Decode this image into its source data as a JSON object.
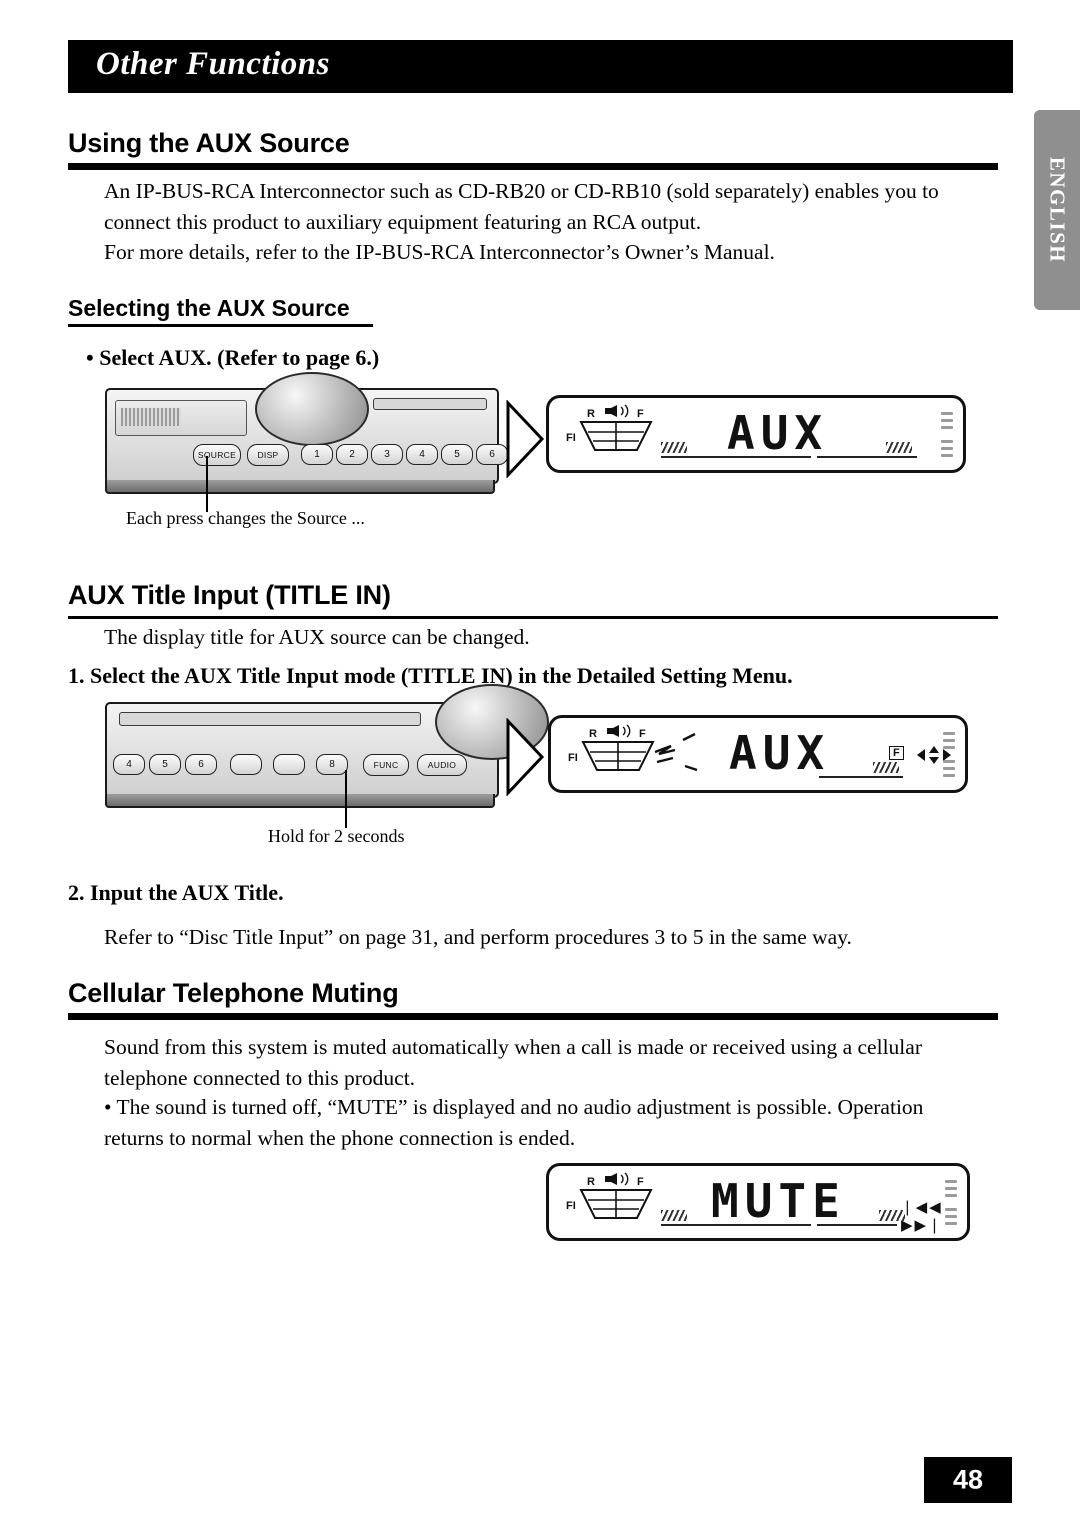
{
  "header": {
    "title": "Other Functions",
    "language_tab": "ENGLISH",
    "page_number": "48"
  },
  "sections": [
    {
      "id": "using-aux-source",
      "heading": "Using the AUX Source",
      "paragraphs": [
        "An IP-BUS-RCA Interconnector such as CD-RB20 or CD-RB10 (sold separately) enables you to connect this product to auxiliary equipment featuring an RCA output.",
        "For more details, refer to the IP-BUS-RCA Interconnector’s Owner’s Manual."
      ],
      "subheading": "Selecting the AUX Source",
      "bullet": "•  Select AUX. (Refer to page 6.)",
      "figure_caption": "Each press changes the Source ..."
    },
    {
      "id": "aux-title-input",
      "heading": "AUX Title Input (TITLE IN)",
      "paragraph": "The display title for AUX source can be changed.",
      "step1": "1.  Select the AUX Title Input mode (TITLE IN) in the Detailed Setting Menu.",
      "figure_caption": "Hold for 2 seconds",
      "step2": "2.  Input the AUX Title.",
      "step2_body": "Refer to “Disc Title Input” on page 31, and perform procedures 3 to 5 in the same way."
    },
    {
      "id": "cellular-telephone-muting",
      "heading": "Cellular Telephone Muting",
      "paragraphs": [
        "Sound from this system is muted automatically when a call is made or received using a cellular telephone connected to this product.",
        "•  The sound is turned off, “MUTE” is displayed and no audio adjustment is possible. Operation returns to normal when the phone connection is ended."
      ]
    }
  ],
  "unit_figures": {
    "top": {
      "buttons": [
        "SOURCE",
        "DISP"
      ],
      "preset_numbers": [
        "1",
        "2",
        "3",
        "4",
        "5",
        "6"
      ]
    },
    "middle": {
      "buttons": [
        "FUNC",
        "AUDIO"
      ],
      "preset_numbers": [
        "4",
        "5",
        "6",
        "8"
      ]
    }
  },
  "displays": [
    {
      "id": "display-aux-1",
      "main_text": "AUX",
      "indicators": [
        "R",
        "F",
        "FI"
      ]
    },
    {
      "id": "display-aux-2",
      "main_text": "AUX",
      "indicators": [
        "R",
        "F",
        "FI"
      ],
      "pad_icon": "F"
    },
    {
      "id": "display-mute",
      "main_text": "MUTE",
      "indicators": [
        "R",
        "F",
        "FI"
      ],
      "pad_icons": "❘◀◀  ▶▶❘"
    }
  ],
  "colors": {
    "bar": "#000000",
    "lang_tab": "#8f8f8f",
    "text": "#000000",
    "page": "#ffffff"
  }
}
